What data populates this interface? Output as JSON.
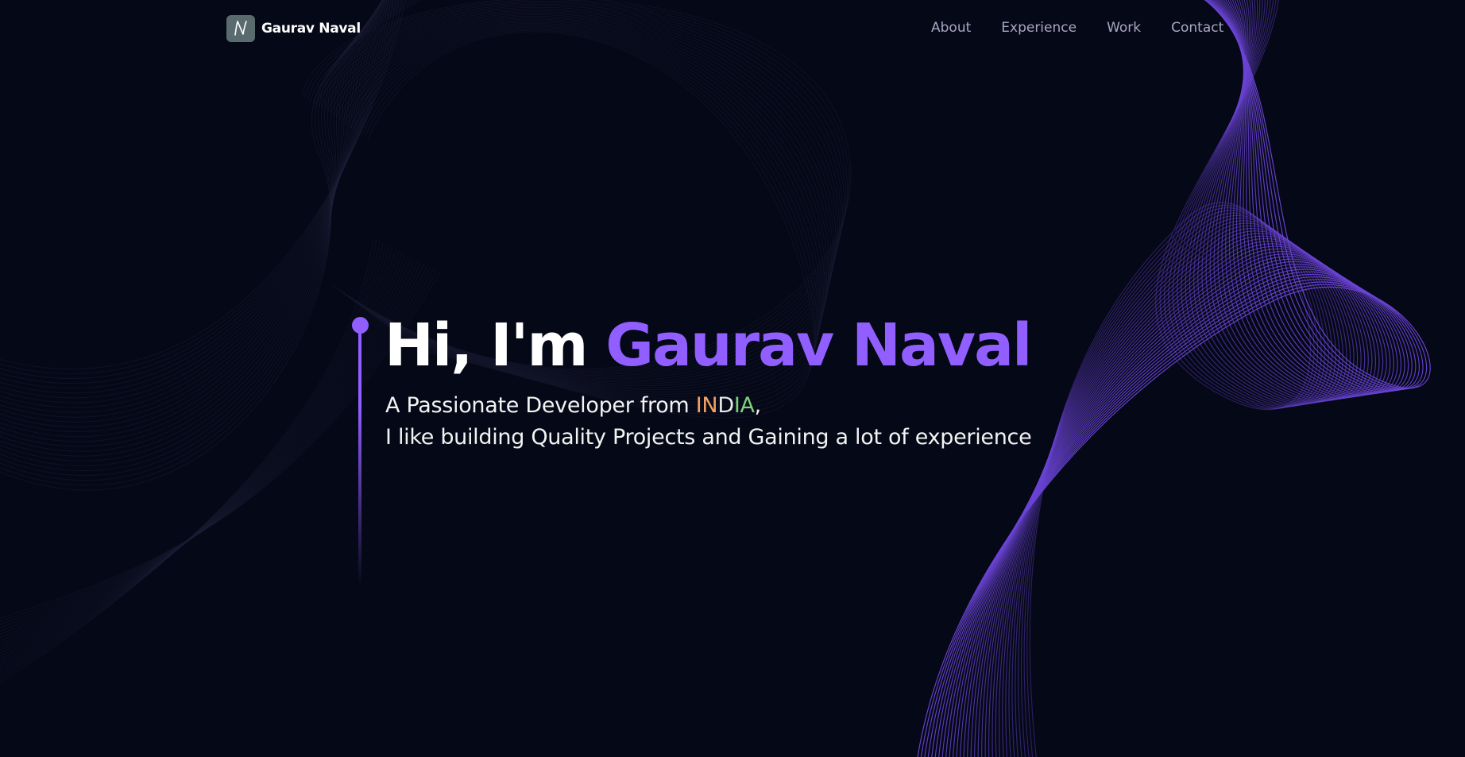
{
  "brand": {
    "logo_icon": "n-signature-logo-icon",
    "name": "Gaurav Naval"
  },
  "nav": {
    "items": [
      {
        "label": "About"
      },
      {
        "label": "Experience"
      },
      {
        "label": "Work"
      },
      {
        "label": "Contact"
      }
    ]
  },
  "hero": {
    "greeting": "Hi, I'm ",
    "name": "Gaurav Naval",
    "line1_prefix": "A Passionate Developer from ",
    "country": "INDIA",
    "line1_suffix": ",",
    "line2": "I like building Quality Projects and Gaining a lot of experience"
  },
  "colors": {
    "background": "#050816",
    "accent": "#915eff",
    "nav_text": "#aaa6c3",
    "india_saffron": "#f4a261",
    "india_green": "#7fd37a"
  }
}
